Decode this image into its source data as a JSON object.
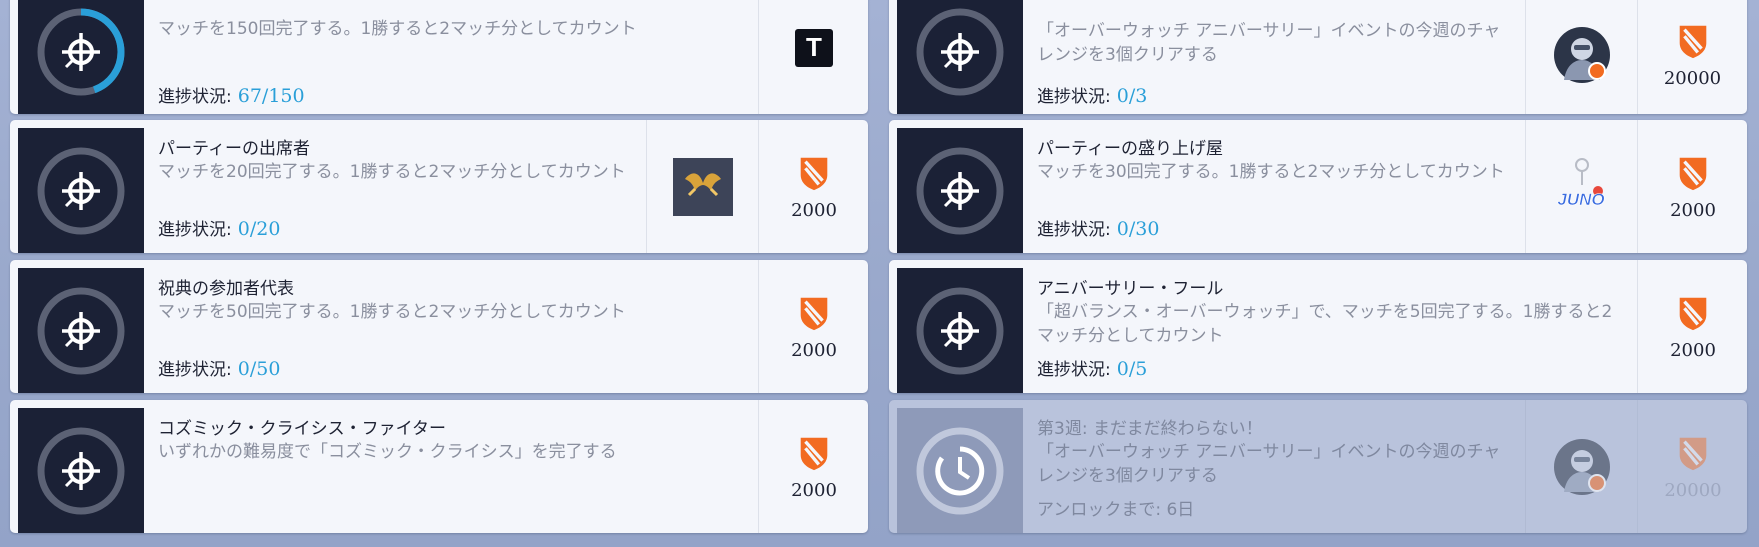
{
  "progress_label": "進捗状況:",
  "left": [
    {
      "desc": "マッチを150回完了する。1勝すると2マッチ分としてカウント",
      "progress": "67/150",
      "progress_fraction": 0.447,
      "reward_icon": "title-t-icon"
    },
    {
      "title": "パーティーの出席者",
      "desc": "マッチを20回完了する。1勝すると2マッチ分としてカウント",
      "progress": "0/20",
      "item_icon": "golden-emblem-icon",
      "amount": "2000"
    },
    {
      "title": "祝典の参加者代表",
      "desc": "マッチを50回完了する。1勝すると2マッチ分としてカウント",
      "progress": "0/50",
      "amount": "2000"
    },
    {
      "title": "コズミック・クライシス・ファイター",
      "desc": "いずれかの難易度で「コズミック・クライシス」を完了する",
      "amount": "2000"
    }
  ],
  "right": [
    {
      "desc": "「オーバーウォッチ アニバーサリー」イベントの今週のチャレンジを3個クリアする",
      "progress": "0/3",
      "item_icon": "hero-avatar-icon",
      "amount": "20000"
    },
    {
      "title": "パーティーの盛り上げ屋",
      "desc": "マッチを30回完了する。1勝すると2マッチ分としてカウント",
      "progress": "0/30",
      "item_icon": "juno-charm-icon",
      "amount": "2000"
    },
    {
      "title": "アニバーサリー・フール",
      "desc": "「超バランス・オーバーウォッチ」で、マッチを5回完了する。1勝すると2マッチ分としてカウント",
      "progress": "0/5",
      "amount": "2000"
    },
    {
      "title": "第3週: まだまだ終わらない！",
      "desc": "「オーバーウォッチ アニバーサリー」イベントの今週のチャレンジを3個クリアする",
      "unlock": "アンロックまで: 6日",
      "item_icon": "hero-avatar-icon",
      "amount": "20000",
      "locked": true
    }
  ],
  "colors": {
    "accent": "#2a9fd8",
    "reward": "#f26b21",
    "card_bg": "#f4f6fb",
    "icon_bg": "#1b2136"
  },
  "icons": {
    "challenge": "crosshair-icon",
    "locked": "timer-icon",
    "reward": "overwatch-coin-icon",
    "juno_text": "JUNO"
  }
}
